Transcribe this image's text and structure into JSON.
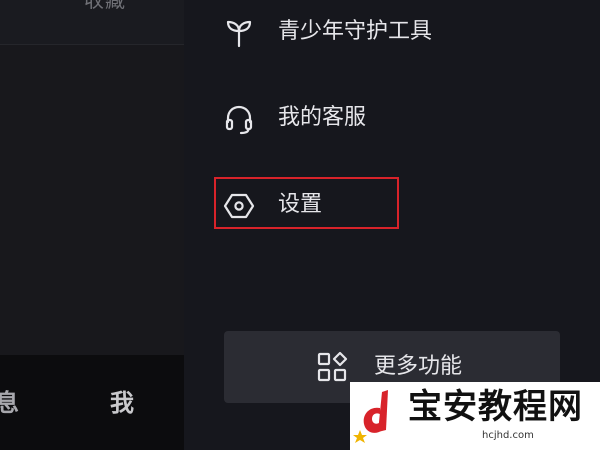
{
  "left_panel": {
    "top_label": "收藏",
    "tabs": [
      {
        "label": "息"
      },
      {
        "label": "我"
      }
    ]
  },
  "drawer": {
    "items": [
      {
        "label": "青少年守护工具",
        "icon": "sprout-icon"
      },
      {
        "label": "我的客服",
        "icon": "headset-icon"
      },
      {
        "label": "设置",
        "icon": "hexagon-settings-icon"
      }
    ],
    "highlight_color": "#d8232a",
    "more_button": {
      "label": "更多功能",
      "icon": "grid-apps-icon"
    }
  },
  "watermark": {
    "title": "宝安教程网",
    "url": "hcjhd.com",
    "logo_color": "#d8232a"
  }
}
